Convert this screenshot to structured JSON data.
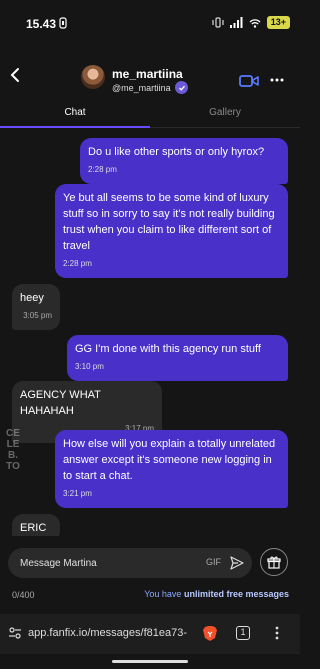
{
  "status_bar": {
    "time": "15.43",
    "battery": "13+"
  },
  "header": {
    "username": "me_martiina",
    "handle": "@me_martiina"
  },
  "tabs": [
    {
      "label": "Chat"
    },
    {
      "label": "Gallery"
    }
  ],
  "messages": [
    {
      "direction": "sent",
      "text": "Do u like other sports or only hyrox?",
      "time": "2:28 pm"
    },
    {
      "direction": "sent",
      "text": "Ye but all seems to be some kind of luxury stuff so in sorry to say it's not really building trust when you claim to like different sort of travel",
      "time": "2:28 pm"
    },
    {
      "direction": "received",
      "text": "heey",
      "time": "3:05 pm"
    },
    {
      "direction": "sent",
      "text": "GG I'm done with this agency run stuff",
      "time": "3:10 pm"
    },
    {
      "direction": "received",
      "text": "AGENCY WHAT HAHAHAH",
      "time": "3:17 pm"
    },
    {
      "direction": "sent",
      "text": "How else will you explain a totally unrelated answer except it's someone new logging in to start a chat.",
      "time": "3:21 pm"
    },
    {
      "direction": "received",
      "text": "ERIC",
      "time": ""
    }
  ],
  "composer": {
    "placeholder": "Message Martina",
    "gif_label": "GIF"
  },
  "footer": {
    "counter": "0/400",
    "unlimited_prefix": "You have ",
    "unlimited_bold": "unlimited free messages"
  },
  "browser": {
    "url": "app.fanfix.io/messages/f81ea73-",
    "tab_count": "1"
  },
  "watermark": {
    "text": "CELEB.TO"
  },
  "colors": {
    "accent": "#4830c8",
    "tab_indicator": "#6a4aff",
    "background": "#151515"
  },
  "icons": [
    "back-icon",
    "video-call-icon",
    "more-icon",
    "verified-icon",
    "send-icon",
    "gift-icon",
    "settings-icon",
    "brave-icon",
    "menu-icon"
  ]
}
